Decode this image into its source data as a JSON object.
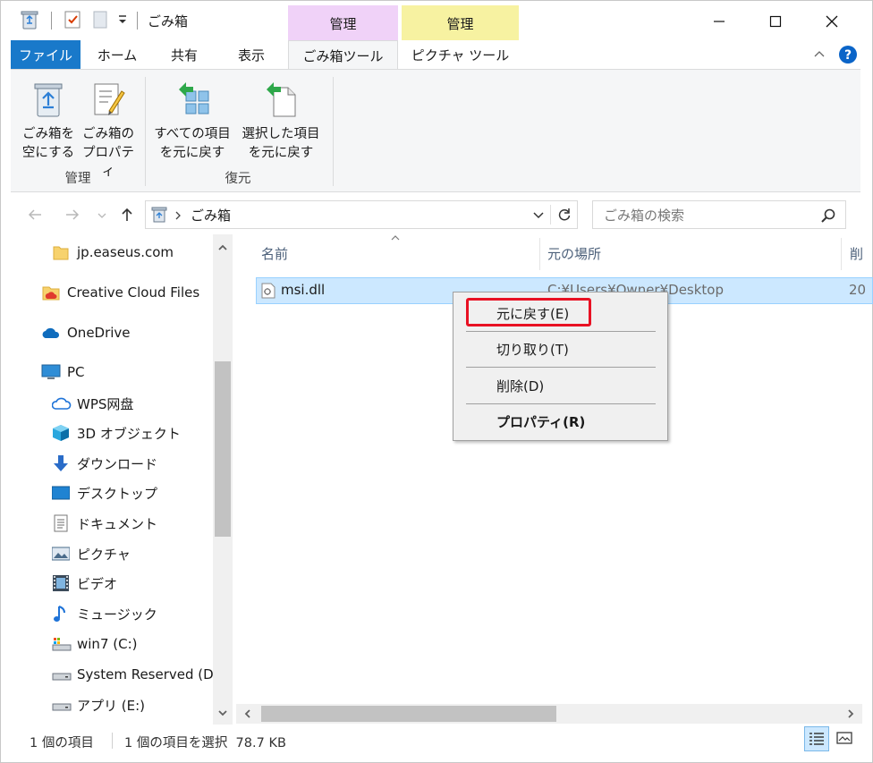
{
  "window": {
    "title": "ごみ箱",
    "minimize_glyph": "—",
    "maximize_glyph": "☐",
    "close_glyph": "✕"
  },
  "contextual_tabs": {
    "recycle_group": "管理",
    "picture_group": "管理"
  },
  "ribbon_tabs": [
    {
      "label": "ファイル"
    },
    {
      "label": "ホーム"
    },
    {
      "label": "共有"
    },
    {
      "label": "表示"
    },
    {
      "label": "ごみ箱ツール"
    },
    {
      "label": "ピクチャ ツール"
    }
  ],
  "ribbon": {
    "empty_bin": {
      "line1": "ごみ箱を",
      "line2": "空にする"
    },
    "bin_props": {
      "line1": "ごみ箱の",
      "line2": "プロパティ"
    },
    "group_manage": "管理",
    "restore_all": {
      "line1": "すべての項目",
      "line2": "を元に戻す"
    },
    "restore_selected": {
      "line1": "選択した項目",
      "line2": "を元に戻す"
    },
    "group_restore": "復元"
  },
  "address_bar": {
    "path": "ごみ箱",
    "search_placeholder": "ごみ箱の検索"
  },
  "nav_pane": {
    "items": [
      {
        "label": "jp.easeus.com",
        "icon": "folder-icon"
      },
      {
        "label": "Creative Cloud Files",
        "icon": "creative-cloud-icon"
      },
      {
        "label": "OneDrive",
        "icon": "onedrive-icon"
      },
      {
        "label": "PC",
        "icon": "pc-icon"
      },
      {
        "label": "WPS网盘",
        "icon": "cloud-icon"
      },
      {
        "label": "3D オブジェクト",
        "icon": "cube-icon"
      },
      {
        "label": "ダウンロード",
        "icon": "download-icon"
      },
      {
        "label": "デスクトップ",
        "icon": "desktop-icon"
      },
      {
        "label": "ドキュメント",
        "icon": "document-icon"
      },
      {
        "label": "ピクチャ",
        "icon": "picture-icon"
      },
      {
        "label": "ビデオ",
        "icon": "video-icon"
      },
      {
        "label": "ミュージック",
        "icon": "music-icon"
      },
      {
        "label": "win7 (C:)",
        "icon": "drive-c-icon"
      },
      {
        "label": "System Reserved (D:)",
        "icon": "drive-icon"
      },
      {
        "label": "アプリ (E:)",
        "icon": "drive-icon"
      }
    ]
  },
  "file_list": {
    "columns": [
      "名前",
      "元の場所",
      "削"
    ],
    "rows": [
      {
        "name": "msi.dll",
        "location": "C:¥Users¥Owner¥Desktop",
        "date": "20"
      }
    ]
  },
  "context_menu": {
    "items": [
      {
        "label": "元に戻す(E)",
        "highlighted": true
      },
      {
        "label": "切り取り(T)"
      },
      {
        "label": "削除(D)"
      },
      {
        "label": "プロパティ(R)",
        "bold": true
      }
    ],
    "highlight_color": "#e81123"
  },
  "status_bar": {
    "item_count": "1 個の項目",
    "selected_info": "1 個の項目を選択  78.7 KB"
  },
  "colors": {
    "file_tab": "#1979ca",
    "recycle_ctx": "#f0d2f8",
    "picture_ctx": "#f7f2a1",
    "selection": "#cce8ff",
    "help": "#0a64c8"
  }
}
